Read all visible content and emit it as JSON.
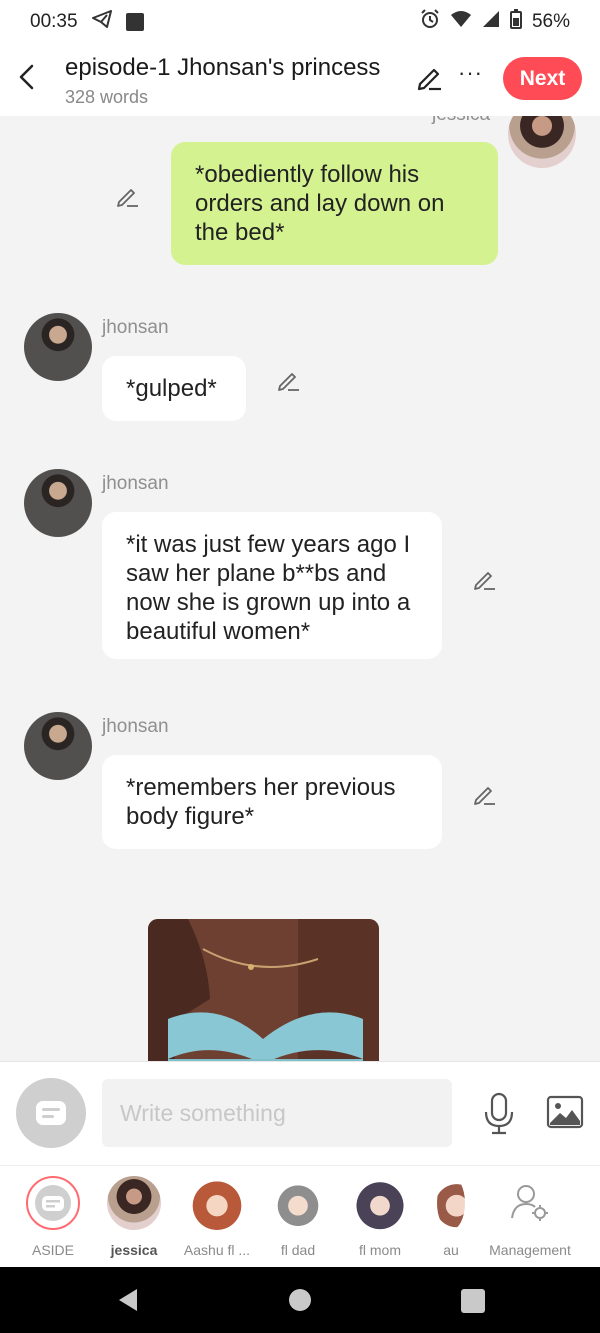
{
  "status": {
    "time": "00:35",
    "battery": "56%"
  },
  "header": {
    "title": "episode-1 Jhonsan's princess",
    "word_count": "328 words",
    "next_label": "Next"
  },
  "messages": [
    {
      "speaker": "jessica",
      "text": "*obediently follow his orders and lay down on the bed*",
      "side": "right"
    },
    {
      "speaker": "jhonsan",
      "text": "*gulped*",
      "side": "left"
    },
    {
      "speaker": "jhonsan",
      "text": "*it was just few years ago I saw her plane b**bs and now she is grown up into a beautiful women*",
      "side": "left"
    },
    {
      "speaker": "jhonsan",
      "text": "*remembers her previous body figure*",
      "side": "left"
    }
  ],
  "input": {
    "placeholder": "Write something"
  },
  "characters": [
    {
      "label": "ASIDE",
      "icon": "aside-icon"
    },
    {
      "label": "jessica",
      "icon": "jessica-avatar"
    },
    {
      "label": "Aashu fl ...",
      "icon": "aashu-avatar"
    },
    {
      "label": "fl dad",
      "icon": "fl-dad-avatar"
    },
    {
      "label": "fl mom",
      "icon": "fl-mom-avatar"
    },
    {
      "label": "au",
      "icon": "au-avatar"
    },
    {
      "label": "Management",
      "icon": "management-icon"
    }
  ],
  "colors": {
    "accent": "#ff4b55",
    "user_bubble": "#d5f291",
    "bubble": "#ffffff",
    "background": "#f3f3f3"
  }
}
